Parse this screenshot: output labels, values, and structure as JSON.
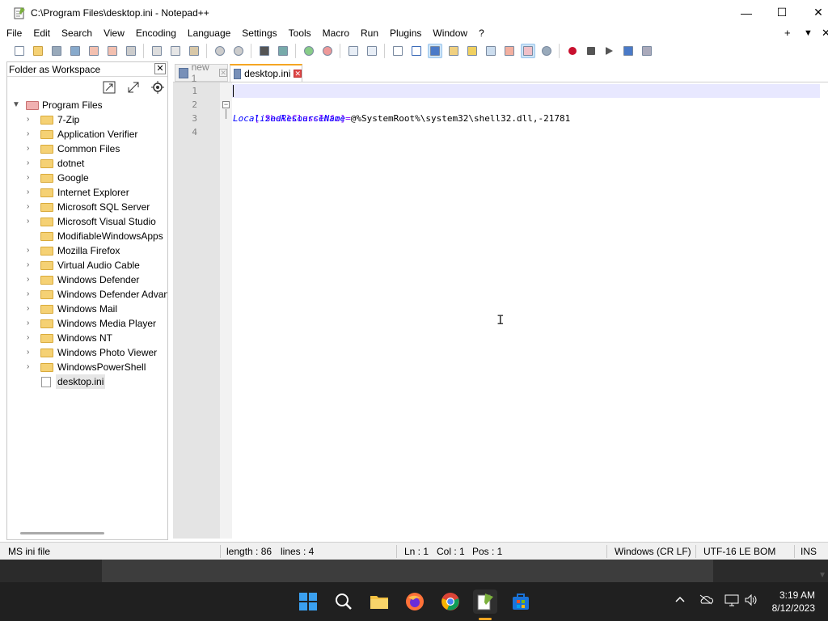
{
  "window": {
    "title": "C:\\Program Files\\desktop.ini - Notepad++",
    "minimize_glyph": "—",
    "maximize_glyph": "☐",
    "close_glyph": "✕"
  },
  "menubar": {
    "items": [
      "File",
      "Edit",
      "Search",
      "View",
      "Encoding",
      "Language",
      "Settings",
      "Tools",
      "Macro",
      "Run",
      "Plugins",
      "Window",
      "?"
    ],
    "plus": "+",
    "dropdown": "▼",
    "close": "✕"
  },
  "panel": {
    "title": "Folder as Workspace",
    "close": "✕",
    "root": "Program Files",
    "folders": [
      "7-Zip",
      "Application Verifier",
      "Common Files",
      "dotnet",
      "Google",
      "Internet Explorer",
      "Microsoft SQL Server",
      "Microsoft Visual Studio",
      "ModifiableWindowsApps",
      "Mozilla Firefox",
      "Virtual Audio Cable",
      "Windows Defender",
      "Windows Defender Advan",
      "Windows Mail",
      "Windows Media Player",
      "Windows NT",
      "Windows Photo Viewer",
      "WindowsPowerShell"
    ],
    "file": "desktop.ini"
  },
  "tabs": [
    {
      "label": "new 1",
      "active": false
    },
    {
      "label": "desktop.ini",
      "active": true
    }
  ],
  "editor": {
    "line_numbers": [
      "1",
      "2",
      "3",
      "4"
    ],
    "line2_section": "[.ShellClassInfo]",
    "line3_key": "LocalizedResourceName",
    "line3_eq": "=",
    "line3_value": "@%SystemRoot%\\system32\\shell32.dll,-21781"
  },
  "status": {
    "filetype": "MS ini file",
    "length": "length : 86",
    "lines": "lines : 4",
    "ln": "Ln : 1",
    "col": "Col : 1",
    "pos": "Pos : 1",
    "eol": "Windows (CR LF)",
    "encoding": "UTF-16 LE BOM",
    "mode": "INS"
  },
  "taskbar": {
    "time": "3:19 AM",
    "date": "8/12/2023"
  },
  "colors": {
    "accent": "#f5a623",
    "section": "#8000ff",
    "key": "#0000ff",
    "taskbar": "#202020"
  }
}
